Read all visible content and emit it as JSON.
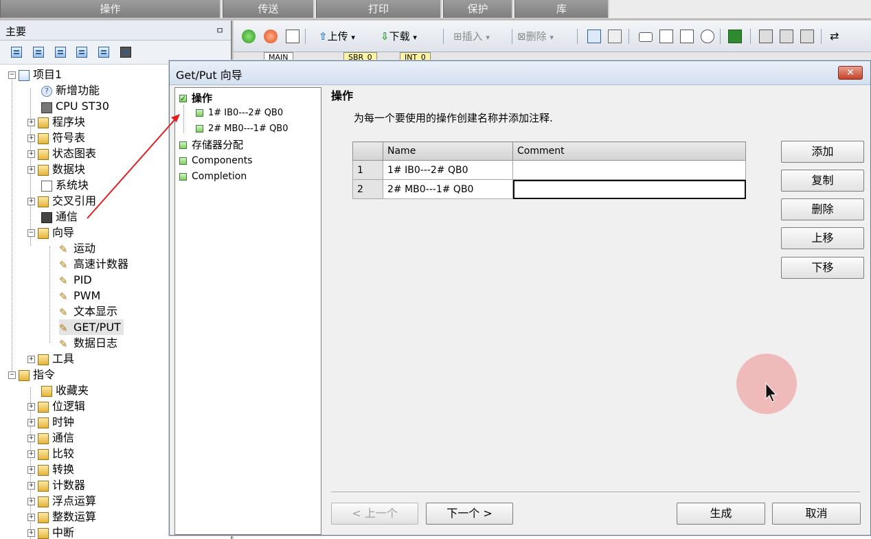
{
  "top_tabs": [
    "操作",
    "传送",
    "打印",
    "保护",
    "库"
  ],
  "left_pane": {
    "title": "主要",
    "pin": "ㅁ",
    "tree": [
      {
        "label": "项目1",
        "expander": "−",
        "icon": "project-icon"
      },
      {
        "label": "新增功能",
        "icon": "help-icon"
      },
      {
        "label": "CPU ST30",
        "icon": "cpu-icon"
      },
      {
        "label": "程序块",
        "expander": "+",
        "icon": "folder-icon"
      },
      {
        "label": "符号表",
        "expander": "+",
        "icon": "folder-icon"
      },
      {
        "label": "状态图表",
        "expander": "+",
        "icon": "folder-icon"
      },
      {
        "label": "数据块",
        "expander": "+",
        "icon": "folder-icon"
      },
      {
        "label": "系统块",
        "icon": "document-icon"
      },
      {
        "label": "交叉引用",
        "expander": "+",
        "icon": "folder-icon"
      },
      {
        "label": "通信",
        "icon": "communication-icon"
      },
      {
        "label": "向导",
        "expander": "−",
        "icon": "wizard-folder-icon"
      },
      {
        "label": "运动",
        "icon": "wand-icon"
      },
      {
        "label": "高速计数器",
        "icon": "wand-icon"
      },
      {
        "label": "PID",
        "icon": "wand-icon"
      },
      {
        "label": "PWM",
        "icon": "wand-icon"
      },
      {
        "label": "文本显示",
        "icon": "wand-icon"
      },
      {
        "label": "GET/PUT",
        "icon": "wand-icon"
      },
      {
        "label": "数据日志",
        "icon": "wand-icon"
      },
      {
        "label": "工具",
        "expander": "+",
        "icon": "folder-icon"
      },
      {
        "label": "指令",
        "expander": "−",
        "icon": "instruction-icon"
      },
      {
        "label": "收藏夹",
        "icon": "folder-icon"
      },
      {
        "label": "位逻辑",
        "expander": "+",
        "icon": "folder-icon"
      },
      {
        "label": "时钟",
        "expander": "+",
        "icon": "clock-icon"
      },
      {
        "label": "通信",
        "expander": "+",
        "icon": "lightning-icon"
      },
      {
        "label": "比较",
        "expander": "+",
        "icon": "folder-icon"
      },
      {
        "label": "转换",
        "expander": "+",
        "icon": "folder-icon"
      },
      {
        "label": "计数器",
        "expander": "+",
        "icon": "folder-icon"
      },
      {
        "label": "浮点运算",
        "expander": "+",
        "icon": "folder-icon"
      },
      {
        "label": "整数运算",
        "expander": "+",
        "icon": "folder-icon"
      },
      {
        "label": "中断",
        "expander": "+",
        "icon": "folder-icon"
      }
    ]
  },
  "toolbar": {
    "upload_label": "上传",
    "download_label": "下载",
    "insert_label": "插入",
    "delete_label": "删除",
    "dropdown_glyph": "▾"
  },
  "doc_tabs": [
    "MAIN",
    "SBR_0",
    "INT_0"
  ],
  "dialog": {
    "title": "Get/Put 向导",
    "close_label": "✕",
    "nav": [
      {
        "label": "操作",
        "checked": true
      },
      {
        "label": "1# IB0---2# QB0",
        "checked": false
      },
      {
        "label": "2# MB0---1# QB0",
        "checked": false
      },
      {
        "label": "存储器分配",
        "checked": false
      },
      {
        "label": "Components",
        "checked": false
      },
      {
        "label": "Completion",
        "checked": false
      }
    ],
    "section_title": "操作",
    "description": "为每一个要使用的操作创建名称并添加注释.",
    "table": {
      "headers": [
        "",
        "Name",
        "Comment"
      ],
      "rows": [
        {
          "num": "1",
          "name": "1# IB0---2# QB0",
          "comment": ""
        },
        {
          "num": "2",
          "name": "2# MB0---1# QB0",
          "comment": ""
        }
      ]
    },
    "side_buttons": {
      "add": "添加",
      "copy": "复制",
      "delete": "删除",
      "move_up": "上移",
      "move_down": "下移"
    },
    "bottom_buttons": {
      "prev": "< 上一个",
      "next": "下一个 >",
      "generate": "生成",
      "cancel": "取消"
    }
  },
  "colors": {
    "annotation_arrow": "#e02020",
    "cursor_halo": "#ee9696",
    "checkbox_green": "#7fcf5e"
  }
}
